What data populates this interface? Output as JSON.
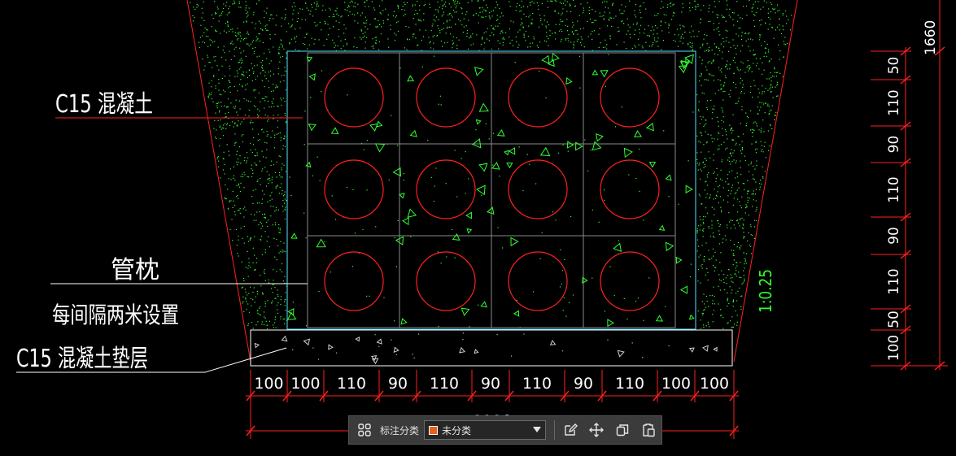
{
  "drawing": {
    "labels": {
      "concrete": "C15 混凝土",
      "pipe_pillow": "管枕",
      "pillow_spacing": "每间隔两米设置",
      "cushion": "C15 混凝土垫层",
      "slope": "1:0.25"
    },
    "horizontal_dims": [
      "100",
      "100",
      "110",
      "90",
      "110",
      "90",
      "110",
      "90",
      "110",
      "100",
      "100"
    ],
    "horizontal_total": "1110",
    "vertical_dims": [
      "50",
      "110",
      "90",
      "110",
      "90",
      "110",
      "50",
      "100"
    ],
    "vertical_total": "1660",
    "colors": {
      "background": "#000000",
      "pipe": "#ff2020",
      "dimension": "#ff2020",
      "trench": "#ff2020",
      "grid": "#8a8a8a",
      "box": "#55e0ff",
      "hatch": "#30ff30",
      "text": "#ffffff"
    }
  },
  "toolbar": {
    "grid_icon": "apps-grid-icon",
    "category_label": "标注分类",
    "selected_category": "未分类",
    "selected_color": "#e8621c",
    "edit_icon": "edit-icon",
    "move_icon": "move-icon",
    "copy_icon": "copy-icon",
    "paste_icon": "paste-icon"
  }
}
